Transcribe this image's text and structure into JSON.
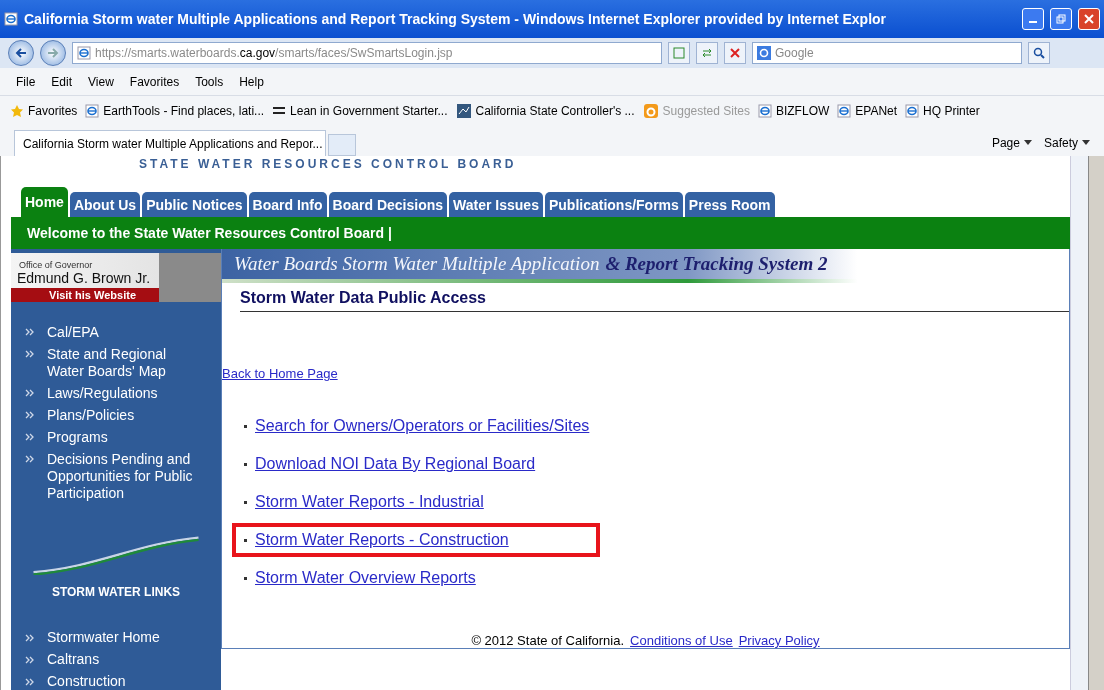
{
  "window": {
    "title": "California Storm water Multiple Applications and Report Tracking System - Windows Internet Explorer provided by Internet Explor"
  },
  "address_bar": {
    "url_prefix": "https://smarts.waterboards.",
    "url_domain": "ca.gov",
    "url_path": "/smarts/faces/SwSmartsLogin.jsp",
    "search_placeholder": "Google"
  },
  "menu": [
    "File",
    "Edit",
    "View",
    "Favorites",
    "Tools",
    "Help"
  ],
  "favorites_bar": {
    "label": "Favorites",
    "items": [
      {
        "label": "EarthTools - Find places, lati...",
        "kind": "ie",
        "disabled": false
      },
      {
        "label": "Lean in Government Starter...",
        "kind": "epa",
        "disabled": false
      },
      {
        "label": "California State Controller's ...",
        "kind": "sco",
        "disabled": false
      },
      {
        "label": "Suggested Sites",
        "kind": "suggested",
        "disabled": true
      },
      {
        "label": "BIZFLOW",
        "kind": "ie",
        "disabled": false
      },
      {
        "label": "EPANet",
        "kind": "ie",
        "disabled": false
      },
      {
        "label": "HQ Printer",
        "kind": "ie",
        "disabled": false
      }
    ]
  },
  "browser_tab": {
    "title": "California Storm water Multiple Applications and Repor..."
  },
  "command_bar": [
    "Page",
    "Safety"
  ],
  "page": {
    "header_title": "STATE WATER RESOURCES CONTROL BOARD",
    "nav_tabs": [
      {
        "label": "Home",
        "selected": true
      },
      {
        "label": "About Us",
        "selected": false
      },
      {
        "label": "Public Notices",
        "selected": false
      },
      {
        "label": "Board Info",
        "selected": false
      },
      {
        "label": "Board Decisions",
        "selected": false
      },
      {
        "label": "Water Issues",
        "selected": false
      },
      {
        "label": "Publications/Forms",
        "selected": false
      },
      {
        "label": "Press Room",
        "selected": false
      }
    ],
    "welcome": "Welcome to the State Water Resources Control Board |",
    "governor": {
      "office": "Office of Governor",
      "name": "Edmund G. Brown Jr.",
      "link": "Visit his Website"
    },
    "sidebar_links": [
      "Cal/EPA",
      "State and Regional Water Boards' Map",
      "Laws/Regulations",
      "Plans/Policies",
      "Programs",
      "Decisions Pending and Opportunities for Public Participation"
    ],
    "sidebar_section": "STORM WATER LINKS",
    "storm_links": [
      "Stormwater Home",
      "Caltrans",
      "Construction"
    ],
    "banner": {
      "title": "Water Boards  Storm Water Multiple Application",
      "title_end": "& Report Tracking System 2"
    },
    "heading": "Storm Water Data Public Access",
    "back_link": "Back to Home Page",
    "links": [
      {
        "label": "Search for Owners/Operators or Facilities/Sites",
        "highlighted": false
      },
      {
        "label": "Download NOI Data By Regional Board",
        "highlighted": false
      },
      {
        "label": "Storm Water Reports - Industrial",
        "highlighted": false
      },
      {
        "label": "Storm Water Reports - Construction",
        "highlighted": true
      },
      {
        "label": "Storm Water Overview Reports",
        "highlighted": false
      }
    ],
    "footer": {
      "copyright": "© 2012 State of California.",
      "links": [
        "Conditions of Use",
        "Privacy Policy"
      ]
    }
  }
}
